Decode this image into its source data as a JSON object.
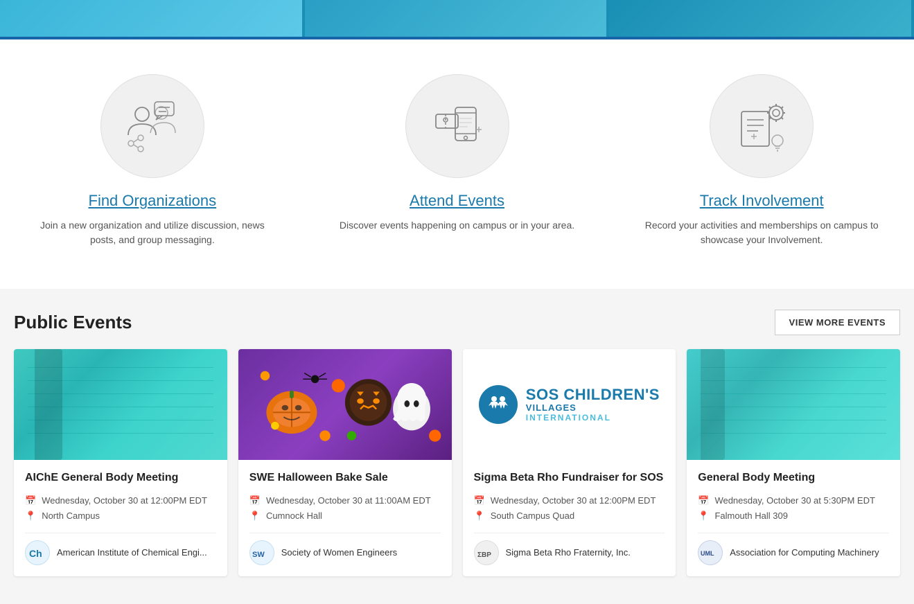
{
  "hero": {
    "segments": [
      "seg1",
      "seg2",
      "seg3"
    ]
  },
  "features": [
    {
      "id": "find-orgs",
      "title": "Find Organizations",
      "description": "Join a new organization and utilize discussion, news posts, and group messaging.",
      "icon": "people-chat-icon"
    },
    {
      "id": "attend-events",
      "title": "Attend Events",
      "description": "Discover events happening on campus or in your area.",
      "icon": "ticket-mobile-icon"
    },
    {
      "id": "track-involvement",
      "title": "Track Involvement",
      "description": "Record your activities and memberships on campus to showcase your Involvement.",
      "icon": "list-gear-icon"
    }
  ],
  "events_section": {
    "title": "Public Events",
    "view_more_label": "VIEW MORE EVENTS"
  },
  "events": [
    {
      "id": "aiche-general",
      "name": "AIChE General Body Meeting",
      "date": "Wednesday, October 30 at 12:00PM EDT",
      "location": "North Campus",
      "org_name": "American Institute of Chemical Engi...",
      "org_initials": "Ch",
      "org_class": "org-aiche",
      "image_type": "teal-notebook"
    },
    {
      "id": "swe-bake",
      "name": "SWE Halloween Bake Sale",
      "date": "Wednesday, October 30 at 11:00AM EDT",
      "location": "Cumnock Hall",
      "org_name": "Society of Women Engineers",
      "org_initials": "SW",
      "org_class": "org-swe",
      "image_type": "cookie"
    },
    {
      "id": "sigma-sos",
      "name": "Sigma Beta Rho Fundraiser for SOS",
      "date": "Wednesday, October 30 at 12:00PM EDT",
      "location": "South Campus Quad",
      "org_name": "Sigma Beta Rho Fraternity, Inc.",
      "org_initials": "ΣΒΡ",
      "org_class": "org-sigma",
      "image_type": "sos"
    },
    {
      "id": "acm-general",
      "name": "General Body Meeting",
      "date": "Wednesday, October 30 at 5:30PM EDT",
      "location": "Falmouth Hall 309",
      "org_name": "Association for Computing Machinery",
      "org_initials": "UML",
      "org_class": "org-acm",
      "image_type": "teal-notebook-2"
    }
  ]
}
